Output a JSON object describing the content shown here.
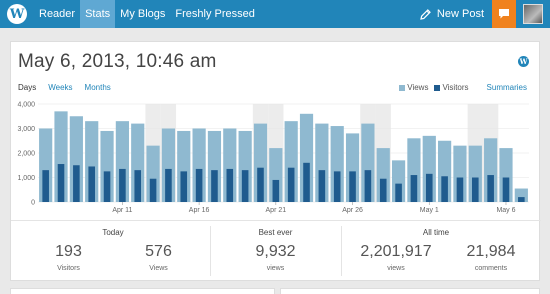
{
  "topbar": {
    "nav": [
      "Reader",
      "Stats",
      "My Blogs",
      "Freshly Pressed"
    ],
    "active_nav": "Stats",
    "new_post": "New Post"
  },
  "stats": {
    "title": "May 6, 2013, 10:46 am",
    "tabs": [
      "Days",
      "Weeks",
      "Months"
    ],
    "active_tab": "Days",
    "legend": {
      "views": "Views",
      "visitors": "Visitors",
      "summaries": "Summaries"
    },
    "today": {
      "label": "Today",
      "visitors": "193",
      "visitors_label": "Visitors",
      "views": "576",
      "views_label": "Views"
    },
    "best_ever": {
      "label": "Best ever",
      "views": "9,932",
      "views_label": "views"
    },
    "all_time": {
      "label": "All time",
      "views": "2,201,917",
      "views_label": "views",
      "comments": "21,984",
      "comments_label": "comments"
    }
  },
  "colors": {
    "brand": "#2185b9",
    "views": "#8fb9d0",
    "visitors": "#1f5b8e",
    "notification": "#f0821e"
  },
  "chart_data": {
    "type": "bar",
    "ylim": [
      0,
      4000
    ],
    "yticks": [
      "0",
      "1,000",
      "2,000",
      "3,000",
      "4,000"
    ],
    "ytick_values": [
      0,
      1000,
      2000,
      3000,
      4000
    ],
    "xtick_labels": [
      "Apr 11",
      "Apr 16",
      "Apr 21",
      "Apr 26",
      "May 1",
      "May 6"
    ],
    "xtick_indices": [
      5,
      10,
      15,
      20,
      25,
      30
    ],
    "weekend_indices": [
      7,
      8,
      14,
      15,
      21,
      22,
      28,
      29
    ],
    "series": [
      {
        "name": "Views",
        "values": [
          3000,
          3700,
          3500,
          3300,
          2900,
          3300,
          3200,
          2300,
          3000,
          2900,
          3000,
          2900,
          3000,
          2900,
          3200,
          2200,
          3300,
          3600,
          3200,
          3100,
          2800,
          3200,
          2200,
          1700,
          2600,
          2700,
          2500,
          2300,
          2300,
          2600,
          2200,
          550
        ]
      },
      {
        "name": "Visitors",
        "values": [
          1300,
          1550,
          1500,
          1450,
          1250,
          1350,
          1300,
          950,
          1350,
          1250,
          1350,
          1300,
          1350,
          1300,
          1400,
          900,
          1400,
          1600,
          1300,
          1250,
          1250,
          1300,
          950,
          750,
          1100,
          1150,
          1050,
          1000,
          1000,
          1100,
          1000,
          200
        ]
      }
    ]
  }
}
